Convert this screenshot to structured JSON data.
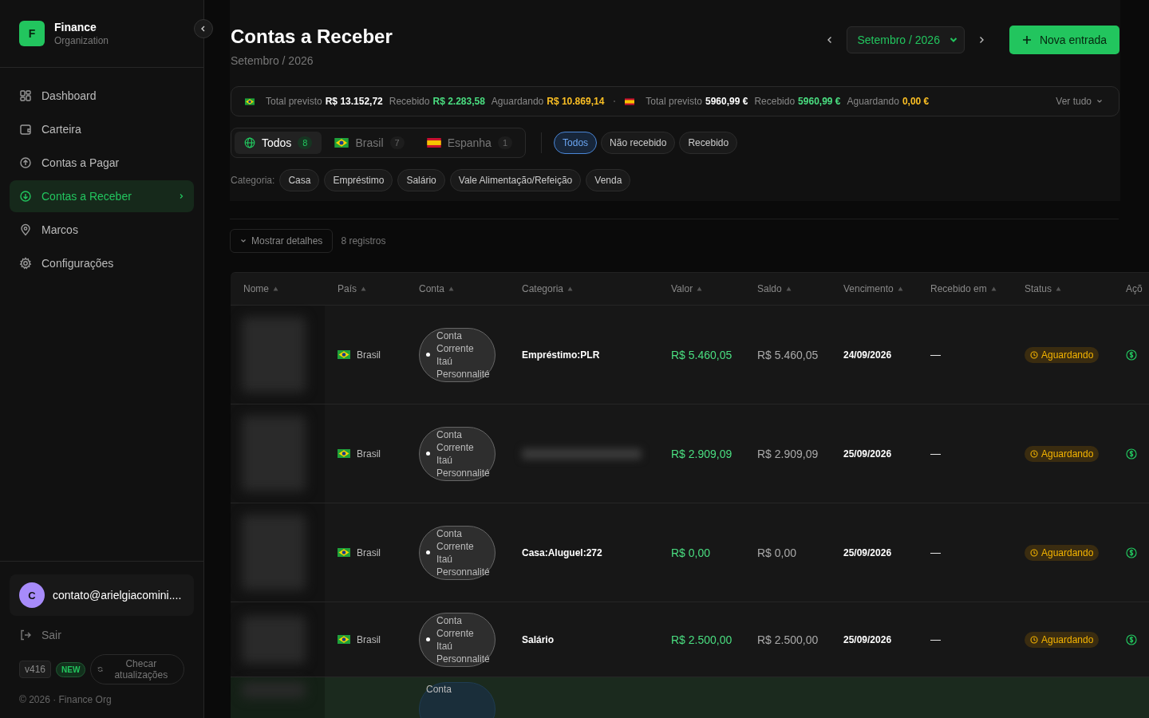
{
  "sidebar": {
    "logo_letter": "F",
    "org_name": "Finance",
    "org_sub": "Organization",
    "items": [
      {
        "label": "Dashboard",
        "kind": "grid",
        "selected": false
      },
      {
        "label": "Carteira",
        "kind": "wallet",
        "selected": false
      },
      {
        "label": "Contas a Pagar",
        "kind": "up",
        "selected": false
      },
      {
        "label": "Contas a Receber",
        "kind": "down",
        "selected": true
      },
      {
        "label": "Marcos",
        "kind": "pin",
        "selected": false
      },
      {
        "label": "Configurações",
        "kind": "gear",
        "selected": false
      }
    ],
    "user": {
      "initial": "C",
      "email": "contato@arielgiacomini...."
    },
    "logout": "Sair",
    "version": "v416",
    "new_badge": "NEW",
    "update_button": "Checar atualizações",
    "footer": "© 2026 · Finance Org"
  },
  "header": {
    "title": "Contas a Receber",
    "subtitle": "Setembro / 2026",
    "month": "Setembro / 2026",
    "new_button": "Nova entrada"
  },
  "summary": {
    "groups": [
      {
        "kind": "br",
        "total_label": "Total previsto",
        "total": "R$ 13.152,72",
        "received_label": "Recebido",
        "received": "R$ 2.283,58",
        "waiting_label": "Aguardando",
        "waiting": "R$ 10.869,14"
      },
      {
        "kind": "es",
        "total_label": "Total previsto",
        "total": "5960,99 €",
        "received_label": "Recebido",
        "received": "5960,99 €",
        "waiting_label": "Aguardando",
        "waiting": "0,00 €"
      }
    ],
    "see_all": "Ver tudo"
  },
  "country_tabs": [
    {
      "kind": "globe",
      "label": "Todos",
      "count": "8",
      "selected": true
    },
    {
      "kind": "br",
      "label": "Brasil",
      "count": "7",
      "selected": false
    },
    {
      "kind": "es",
      "label": "Espanha",
      "count": "1",
      "selected": false
    }
  ],
  "status_chips": [
    {
      "label": "Todos",
      "selected": true
    },
    {
      "label": "Não recebido",
      "selected": false
    },
    {
      "label": "Recebido",
      "selected": false
    }
  ],
  "category_label": "Categoria:",
  "categories": [
    {
      "label": "Casa",
      "selected": false
    },
    {
      "label": "Empréstimo",
      "selected": false
    },
    {
      "label": "Salário",
      "selected": false
    },
    {
      "label": "Vale Alimentação/Refeição",
      "selected": false
    },
    {
      "label": "Venda",
      "selected": false
    }
  ],
  "details_button": "Mostrar detalhes",
  "records": "8 registros",
  "table": {
    "columns": [
      "Nome",
      "País",
      "Conta",
      "Categoria",
      "Valor",
      "Saldo",
      "Vencimento",
      "Recebido em",
      "Status",
      "Açõ"
    ],
    "rows": [
      {
        "selected": false,
        "country": "Brasil",
        "kind": "br",
        "account": "Conta Corrente Itaú Personnalité",
        "category": "Empréstimo:PLR",
        "value": "R$ 5.460,05",
        "balance": "R$ 5.460,05",
        "due": "24/09/2026",
        "received_on": "—",
        "status": "Aguardando"
      },
      {
        "selected": false,
        "country": "Brasil",
        "kind": "br",
        "account": "Conta Corrente Itaú Personnalité",
        "value": "R$ 2.909,09",
        "balance": "R$ 2.909,09",
        "due": "25/09/2026",
        "received_on": "—",
        "status": "Aguardando"
      },
      {
        "selected": false,
        "country": "Brasil",
        "kind": "br",
        "account": "Conta Corrente Itaú Personnalité",
        "category": "Casa:Aluguel:272",
        "value": "R$ 0,00",
        "balance": "R$ 0,00",
        "due": "25/09/2026",
        "received_on": "—",
        "status": "Aguardando"
      },
      {
        "selected": false,
        "country": "Brasil",
        "kind": "br",
        "account": "Conta Corrente Itaú Personnalité",
        "category": "Salário",
        "value": "R$ 2.500,00",
        "balance": "R$ 2.500,00",
        "due": "25/09/2026",
        "received_on": "—",
        "status": "Aguardando"
      },
      {
        "selected": true,
        "account": "Conta"
      }
    ]
  }
}
